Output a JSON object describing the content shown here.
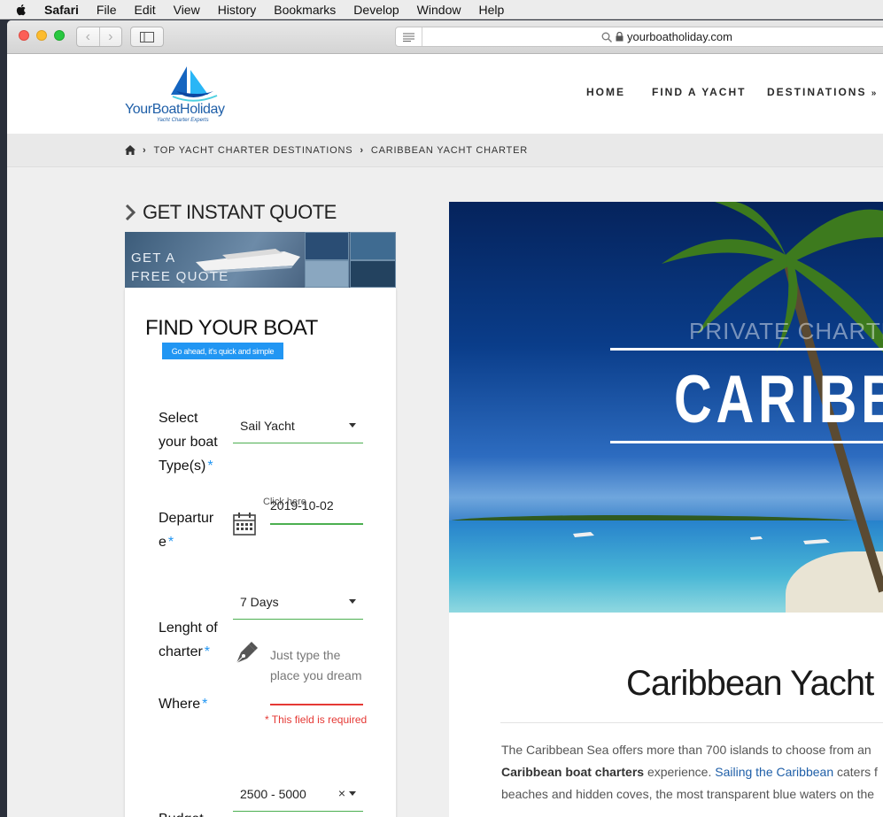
{
  "menubar": {
    "app": "Safari",
    "items": [
      "File",
      "Edit",
      "View",
      "History",
      "Bookmarks",
      "Develop",
      "Window",
      "Help"
    ]
  },
  "browser": {
    "url": "yourboatholiday.com"
  },
  "site": {
    "brand": "YourBoatHoliday",
    "tagline": "Yacht Charter Experts",
    "nav": [
      "HOME",
      "FIND A YACHT",
      "DESTINATIONS"
    ],
    "breadcrumb": [
      "TOP YACHT CHARTER DESTINATIONS",
      "CARIBBEAN YACHT CHARTER"
    ]
  },
  "quote": {
    "heading": "GET INSTANT QUOTE",
    "banner_line1": "GET A",
    "banner_line2": "FREE QUOTE"
  },
  "form": {
    "title": "FIND YOUR BOAT",
    "subtitle": "Go ahead, it's quick and simple",
    "boat_type": {
      "label_lines": [
        "Select",
        "your boat",
        "Type(s)"
      ],
      "value": "Sail Yacht"
    },
    "departure": {
      "label_lines": [
        "Departur",
        "e"
      ],
      "hint": "Click here",
      "value": "2019-10-02"
    },
    "length": {
      "label_lines": [
        "Lenght of",
        "charter"
      ],
      "value": "7 Days"
    },
    "where": {
      "label": "Where",
      "placeholder_lines": [
        "Just type the",
        "place you dream"
      ],
      "error": "* This field is required"
    },
    "budget": {
      "label": "Budget",
      "value": "2500 - 5000",
      "clear": "×"
    },
    "required_mark": "*"
  },
  "hero": {
    "pretitle": "PRIVATE CHARTE",
    "title": "CARIBBE"
  },
  "content": {
    "heading": "Caribbean Yacht",
    "para_line1": "The Caribbean Sea offers more than 700 islands to choose from an",
    "para_line2_bold": "Caribbean boat charters",
    "para_line2_mid": " experience. ",
    "para_line2_link": "Sailing the Caribbean",
    "para_line2_end": " caters f",
    "para_line3": "beaches and hidden coves, the most transparent blue waters on the"
  }
}
